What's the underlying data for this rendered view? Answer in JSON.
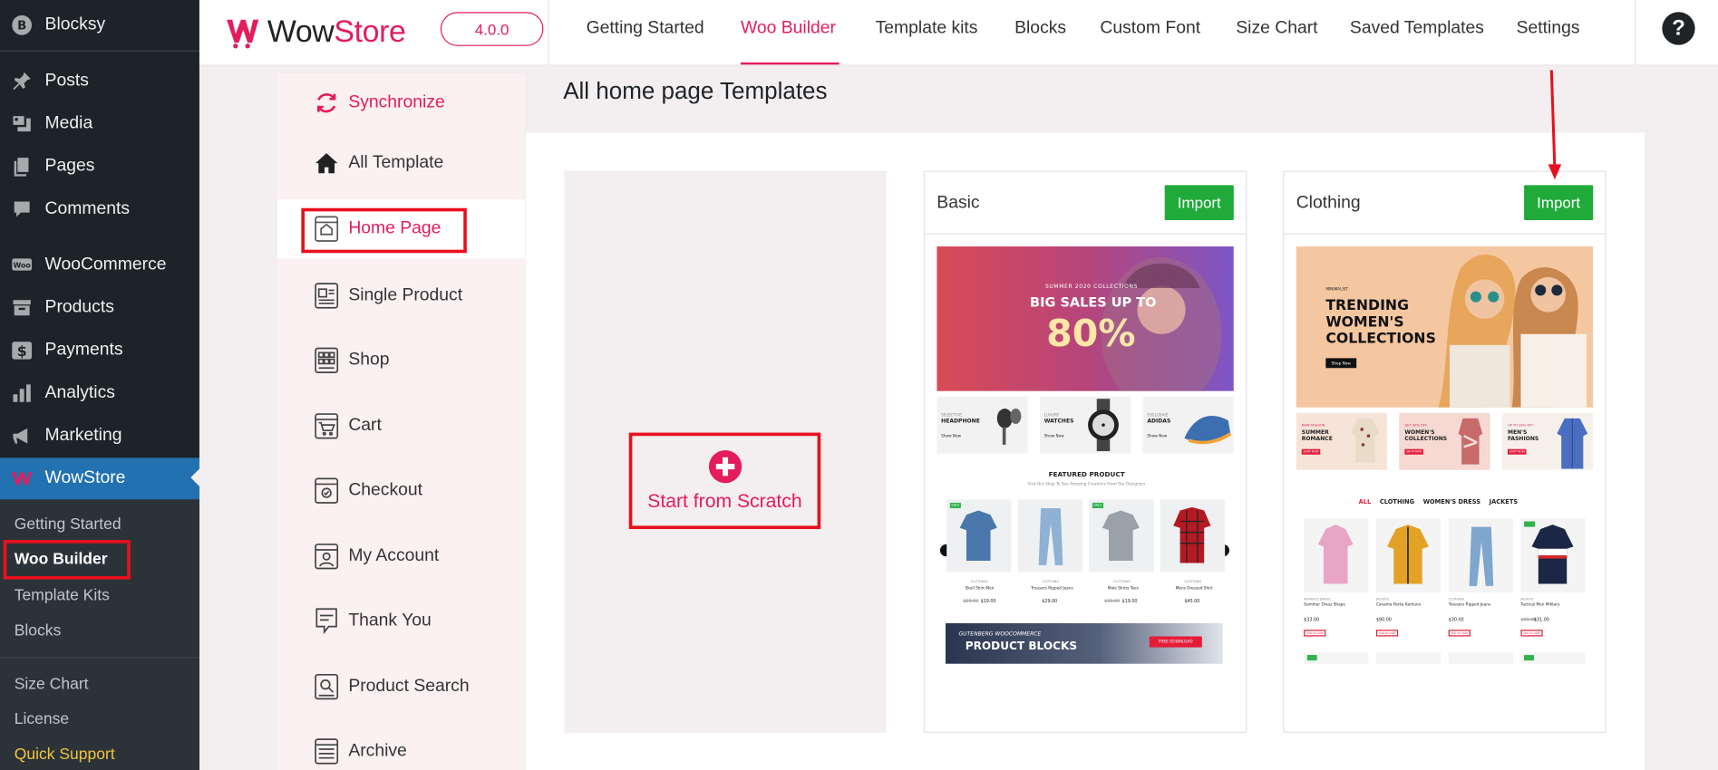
{
  "wp_sidebar": {
    "site_name": "Blocksy",
    "items": [
      {
        "label": "Posts",
        "icon": "pin-icon"
      },
      {
        "label": "Media",
        "icon": "media-icon"
      },
      {
        "label": "Pages",
        "icon": "pages-icon"
      },
      {
        "label": "Comments",
        "icon": "comment-icon"
      },
      {
        "label": "WooCommerce",
        "icon": "woo-icon"
      },
      {
        "label": "Products",
        "icon": "archive-icon"
      },
      {
        "label": "Payments",
        "icon": "dollar-icon"
      },
      {
        "label": "Analytics",
        "icon": "bar-chart-icon"
      },
      {
        "label": "Marketing",
        "icon": "megaphone-icon"
      },
      {
        "label": "WowStore",
        "icon": "wowstore-icon"
      }
    ],
    "submenu": [
      "Getting Started",
      "Woo Builder",
      "Template Kits",
      "Blocks",
      "Size Chart",
      "License",
      "Quick Support"
    ]
  },
  "header": {
    "logo_prefix": "Wow",
    "logo_suffix": "Store",
    "version": "4.0.0",
    "nav": [
      "Getting Started",
      "Woo Builder",
      "Template kits",
      "Blocks",
      "Custom Font",
      "Size Chart",
      "Saved Templates",
      "Settings"
    ],
    "active_nav": "Woo Builder",
    "help": "?"
  },
  "template_sidebar": {
    "items": [
      "Synchronize",
      "All Template",
      "Home Page",
      "Single Product",
      "Shop",
      "Cart",
      "Checkout",
      "My Account",
      "Thank You",
      "Product Search",
      "Archive"
    ],
    "active": "Home Page"
  },
  "main": {
    "title": "All home page Templates",
    "scratch_label": "Start from Scratch",
    "cards": [
      {
        "title": "Basic",
        "button": "Import",
        "preview": {
          "banner_kicker": "SUMMER 2020 COLLECTIONS",
          "banner_headline": "BIG SALES UP TO",
          "banner_percent": "80%",
          "promos": [
            {
              "kicker": "SELECTIVE",
              "name": "HEADPHONE",
              "link": "Show Now"
            },
            {
              "kicker": "LUXURY",
              "name": "WATCHES",
              "link": "Show Now"
            },
            {
              "kicker": "EXCLUSIVE",
              "name": "ADIDAS",
              "link": "Show Now"
            }
          ],
          "section_title": "FEATURED PRODUCT",
          "section_sub": "Visit Our Shop To See Amazing Creations From Our Designers",
          "products": [
            {
              "cat": "CLOTHING",
              "name": "Skull Shirt Men",
              "old": "$29.00",
              "price": "$19.00",
              "badge": "SALE"
            },
            {
              "cat": "CLOTHING",
              "name": "Trousers Ripped Jeans",
              "old": "",
              "price": "$29.00",
              "badge": ""
            },
            {
              "cat": "CLOTHING",
              "name": "Male Shirts Tees",
              "old": "$39.00",
              "price": "$19.00",
              "badge": "SALE"
            },
            {
              "cat": "CLOTHING",
              "name": "Mens Dressed Shirt",
              "old": "",
              "price": "$45.00",
              "badge": ""
            }
          ],
          "footer_kicker": "GUTENBERG WOOCOMMERCE",
          "footer_title": "PRODUCT BLOCKS",
          "footer_button": "FREE DOWNLOAD"
        }
      },
      {
        "title": "Clothing",
        "button": "Import",
        "preview": {
          "banner_kicker": "MINIMALIST",
          "banner_line1": "TRENDING",
          "banner_line2": "WOMEN'S",
          "banner_line3": "COLLECTIONS",
          "banner_button": "Shop Now",
          "promos": [
            {
              "kicker": "NEW FASHION",
              "line1": "SUMMER",
              "line2": "ROMANCE",
              "button": "SHOP NOW"
            },
            {
              "kicker": "GET 30% OFF",
              "line1": "WOMEN'S",
              "line2": "COLLECTIONS",
              "button": "SHOP NOW"
            },
            {
              "kicker": "UP TO 30% OFF",
              "line1": "MEN'S",
              "line2": "FASHIONS",
              "button": "SHOP NOW"
            }
          ],
          "tabs": [
            "ALL",
            "CLOTHING",
            "WOMEN'S DRESS",
            "JACKETS"
          ],
          "products": [
            {
              "cat": "WOMEN'S DRESS",
              "name": "Summer Dress Shape",
              "price": "$33.00",
              "old": "",
              "button": "ADD TO CART"
            },
            {
              "cat": "JACKETS",
              "name": "Canama Parka Kamuno",
              "price": "$90.00",
              "old": "",
              "button": "ADD TO CART"
            },
            {
              "cat": "CLOTHING",
              "name": "Trousers Ripped Jeans",
              "price": "$30.00",
              "old": "",
              "button": "ADD TO CART"
            },
            {
              "cat": "JACKETS",
              "name": "Tactical Men Military",
              "price": "$31.00",
              "old": "$90.00",
              "button": "ADD TO CART"
            }
          ]
        }
      }
    ]
  },
  "colors": {
    "brand": "#e41c5c",
    "wp_sidebar_bg": "#1d2327",
    "wp_active": "#2271b1",
    "import_green": "#1faa3a",
    "annotation_red": "#e8101d"
  }
}
